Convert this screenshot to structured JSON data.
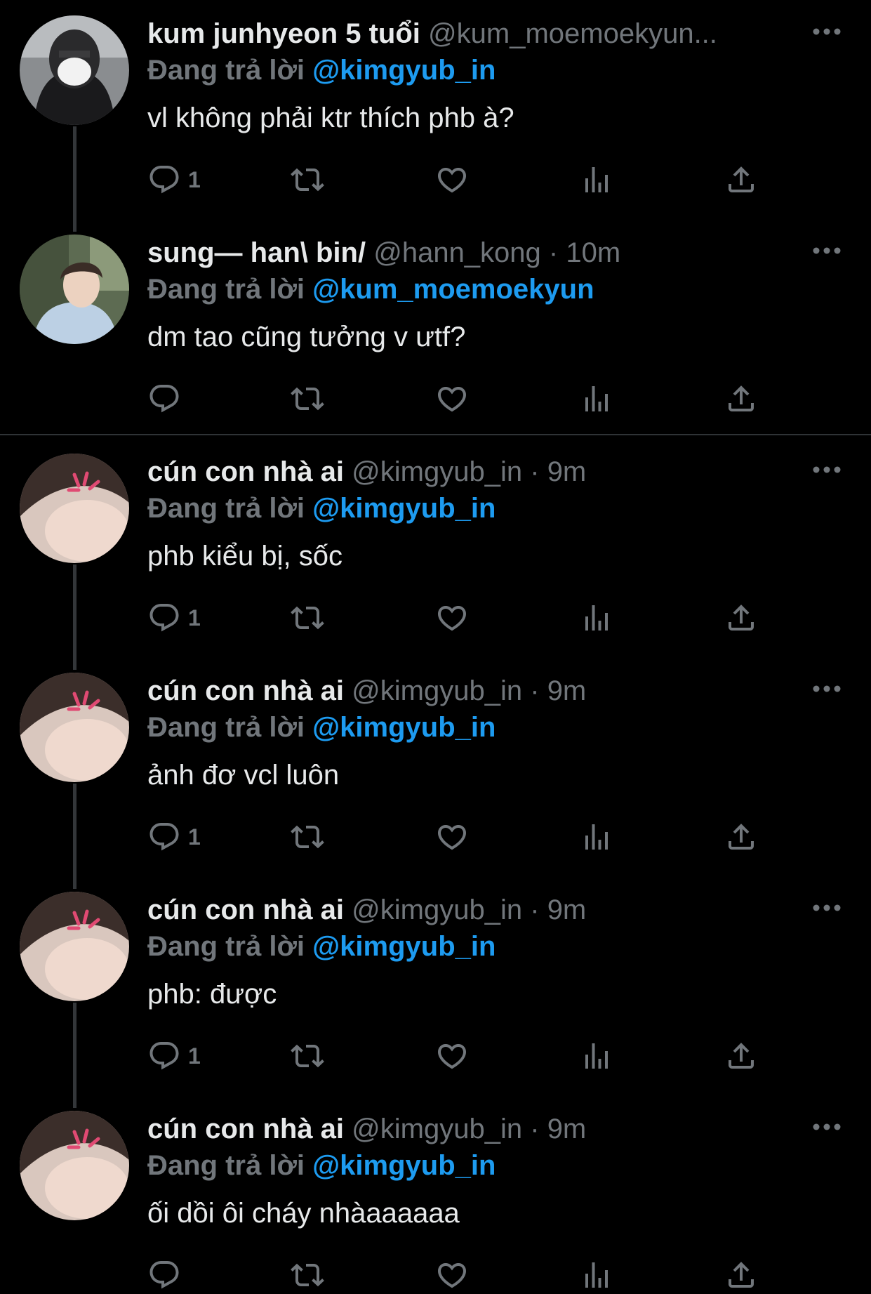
{
  "colors": {
    "background": "#000000",
    "text": "#e7e9ea",
    "muted": "#71767b",
    "link": "#1d9bf0",
    "thread_line": "#333639"
  },
  "icons": [
    "more-icon",
    "reply-icon",
    "retweet-icon",
    "like-icon",
    "views-icon",
    "share-icon"
  ],
  "tweets": [
    {
      "display_name": "kum junhyeon 5 tuổi",
      "handle": "@kum_moemoekyun...",
      "separator": "",
      "time": "",
      "reply_prefix": "Đang trả lời",
      "reply_to": "@kimgyub_in",
      "text": "vl không phải ktr thích phb à?",
      "reply_count": "1"
    },
    {
      "display_name": "sung— han\\ bin/",
      "handle": "@hann_kong",
      "separator": "·",
      "time": "10m",
      "reply_prefix": "Đang trả lời",
      "reply_to": "@kum_moemoekyun",
      "text": "dm tao cũng tưởng v ưtf?",
      "reply_count": ""
    },
    {
      "display_name": "cún con nhà ai",
      "handle": "@kimgyub_in",
      "separator": "·",
      "time": "9m",
      "reply_prefix": "Đang trả lời",
      "reply_to": "@kimgyub_in",
      "text": "phb kiểu bị, sốc",
      "reply_count": "1"
    },
    {
      "display_name": "cún con nhà ai",
      "handle": "@kimgyub_in",
      "separator": "·",
      "time": "9m",
      "reply_prefix": "Đang trả lời",
      "reply_to": "@kimgyub_in",
      "text": "ảnh đơ vcl luôn",
      "reply_count": "1"
    },
    {
      "display_name": "cún con nhà ai",
      "handle": "@kimgyub_in",
      "separator": "·",
      "time": "9m",
      "reply_prefix": "Đang trả lời",
      "reply_to": "@kimgyub_in",
      "text": "phb: được",
      "reply_count": "1"
    },
    {
      "display_name": "cún con nhà ai",
      "handle": "@kimgyub_in",
      "separator": "·",
      "time": "9m",
      "reply_prefix": "Đang trả lời",
      "reply_to": "@kimgyub_in",
      "text": "ối dồi ôi cháy nhàaaaaaa",
      "reply_count": ""
    }
  ]
}
